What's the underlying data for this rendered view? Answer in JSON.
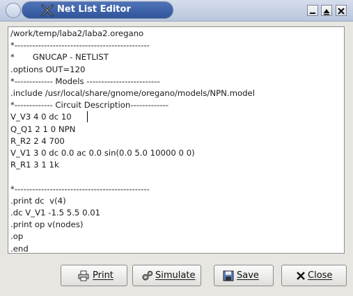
{
  "window": {
    "title": "Net List Editor"
  },
  "title_icon": "x-window-icon",
  "window_controls": [
    "menu-icon",
    "minimize-icon",
    "maximize-icon",
    "close-icon"
  ],
  "editor": {
    "text": "/work/temp/laba2/laba2.oregano\n*----------------------------------------------\n*       GNUCAP - NETLIST\n.options OUT=120\n*------------- Models -------------------------\n.include /usr/local/share/gnome/oregano/models/NPN.model\n*------------- Circuit Description-------------\nV_V3 4 0 dc 10\nQ_Q1 2 1 0 NPN\nR_R2 2 4 700\nV_V1 3 0 dc 0.0 ac 0.0 sin(0.0 5.0 10000 0 0)\nR_R1 3 1 1k\n\n*----------------------------------------------\n.print dc  v(4)\n.dc V_V1 -1.5 5.5 0.01\n.print op v(nodes)\n.op\n.end"
  },
  "buttons": {
    "print": "Print",
    "simulate": "Simulate",
    "save": "Save",
    "close": "Close"
  },
  "button_icons": [
    "printer-icon",
    "gears-icon",
    "floppy-disk-icon",
    "close-x-icon"
  ]
}
